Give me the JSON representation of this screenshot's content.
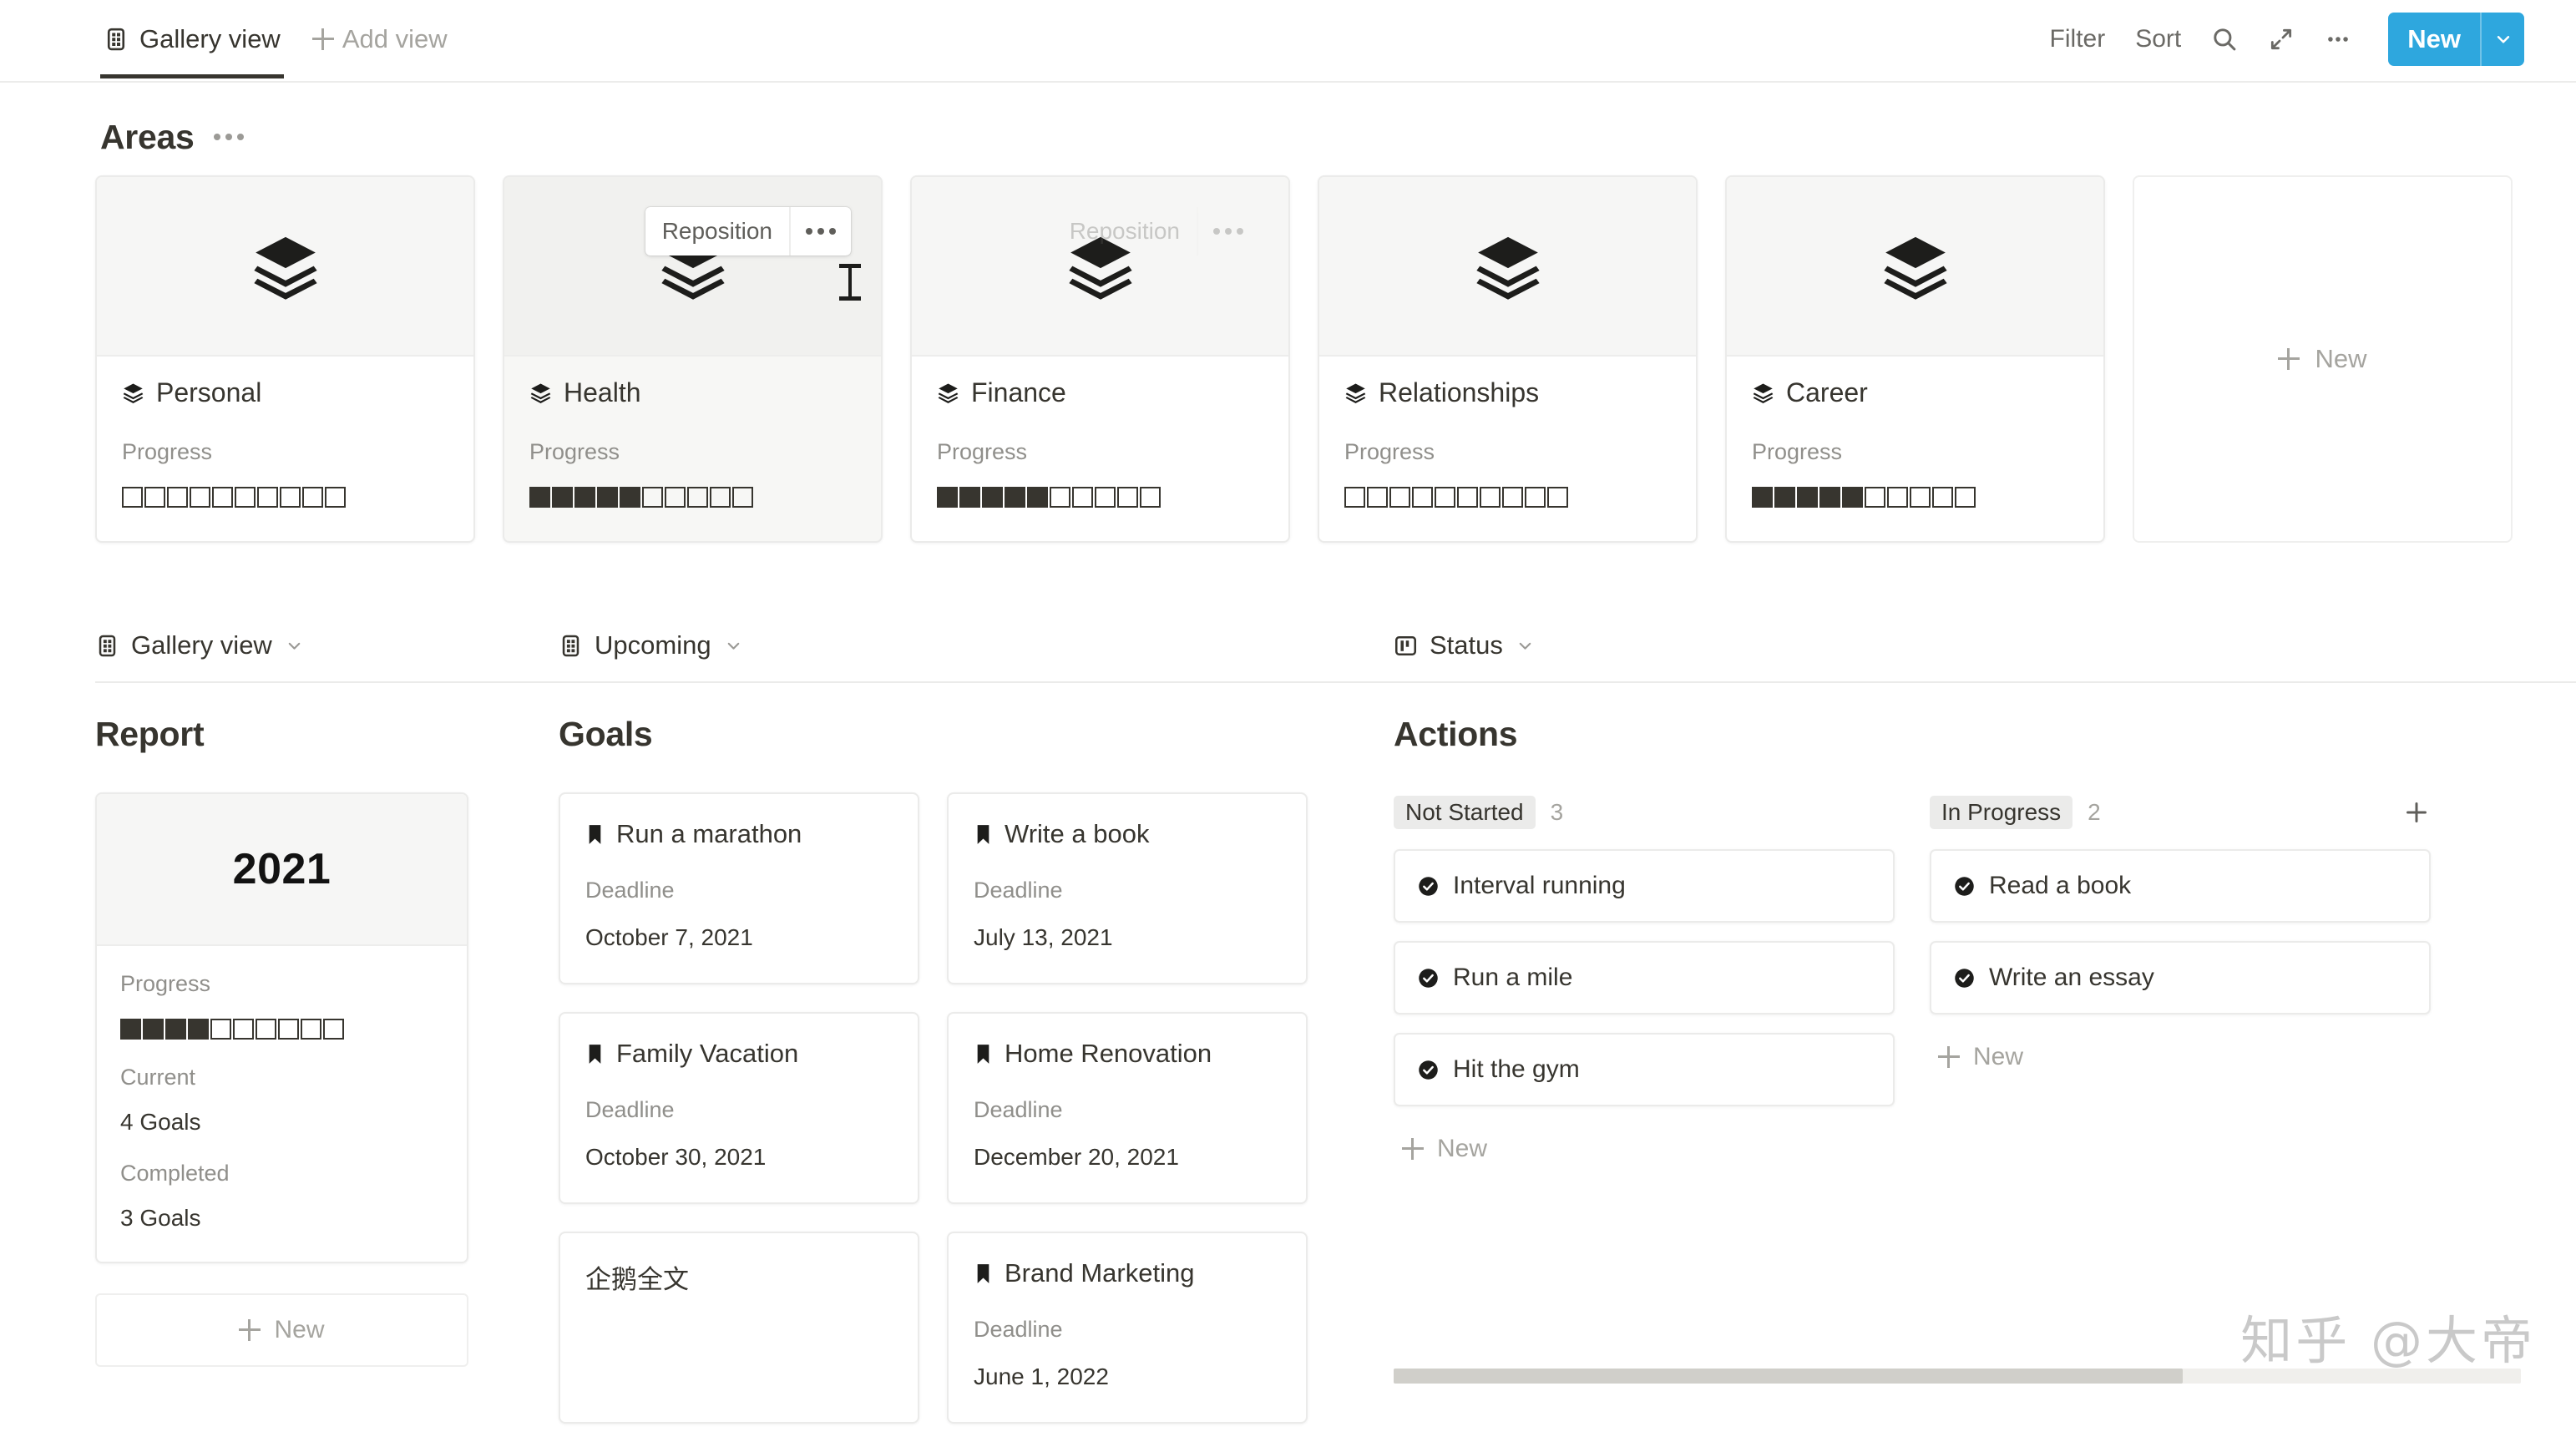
{
  "topbar": {
    "view_tab": {
      "label": "Gallery view",
      "icon": "gallery-grid-icon"
    },
    "add_view": {
      "label": "Add view",
      "icon": "plus-icon"
    },
    "filter_label": "Filter",
    "sort_label": "Sort",
    "search_icon": "search-icon",
    "expand_icon": "expand-arrows-icon",
    "more_icon": "ellipsis-icon",
    "new_button": {
      "label": "New",
      "caret_icon": "chevron-down-icon",
      "color": "#2ea7de"
    }
  },
  "areas_section": {
    "title": "Areas",
    "more_icon": "ellipsis-icon",
    "cards": [
      {
        "title": "Personal",
        "icon": "layers-icon",
        "progress_label": "Progress",
        "filled": 0,
        "total": 10,
        "hovered": false,
        "overlay": "none"
      },
      {
        "title": "Health",
        "icon": "layers-icon",
        "progress_label": "Progress",
        "filled": 5,
        "total": 10,
        "hovered": true,
        "overlay": "active"
      },
      {
        "title": "Finance",
        "icon": "layers-icon",
        "progress_label": "Progress",
        "filled": 5,
        "total": 10,
        "hovered": false,
        "overlay": "ghost"
      },
      {
        "title": "Relationships",
        "icon": "layers-icon",
        "progress_label": "Progress",
        "filled": 0,
        "total": 10,
        "hovered": false,
        "overlay": "none"
      },
      {
        "title": "Career",
        "icon": "layers-icon",
        "progress_label": "Progress",
        "filled": 5,
        "total": 10,
        "hovered": false,
        "overlay": "none"
      }
    ],
    "reposition_label": "Reposition",
    "reposition_dots_icon": "ellipsis-icon",
    "new_card_label": "New"
  },
  "report_column": {
    "linked_view": {
      "label": "Gallery view",
      "icon": "gallery-grid-icon",
      "caret_icon": "chevron-down-icon"
    },
    "db_title": "Report",
    "card": {
      "cover_text": "2021",
      "progress_label": "Progress",
      "filled": 4,
      "total": 10,
      "current_label": "Current",
      "current_value": "4 Goals",
      "completed_label": "Completed",
      "completed_value": "3 Goals"
    },
    "new_label": "New"
  },
  "goals_column": {
    "linked_view": {
      "label": "Upcoming",
      "icon": "gallery-grid-icon",
      "caret_icon": "chevron-down-icon"
    },
    "db_title": "Goals",
    "cards": [
      {
        "title": "Run a marathon",
        "icon": "bookmark-icon",
        "deadline_label": "Deadline",
        "deadline": "October 7, 2021"
      },
      {
        "title": "Write a book",
        "icon": "bookmark-icon",
        "deadline_label": "Deadline",
        "deadline": "July 13, 2021"
      },
      {
        "title": "Family Vacation",
        "icon": "bookmark-icon",
        "deadline_label": "Deadline",
        "deadline": "October 30, 2021"
      },
      {
        "title": "Home Renovation",
        "icon": "bookmark-icon",
        "deadline_label": "Deadline",
        "deadline": "December 20, 2021"
      },
      {
        "title": "企鹅全文",
        "icon": "none",
        "deadline_label": "",
        "deadline": ""
      },
      {
        "title": "Brand Marketing",
        "icon": "bookmark-icon",
        "deadline_label": "Deadline",
        "deadline": "June 1, 2022"
      }
    ]
  },
  "status_column": {
    "linked_view": {
      "label": "Status",
      "icon": "board-kanban-icon",
      "caret_icon": "chevron-down-icon"
    },
    "db_title": "Actions",
    "add_icon": "plus-icon",
    "columns": [
      {
        "status": "Not Started",
        "count": "3",
        "new_label": "New",
        "cards": [
          {
            "title": "Interval running",
            "icon": "check-circle-icon"
          },
          {
            "title": "Run a mile",
            "icon": "check-circle-icon"
          },
          {
            "title": "Hit the gym",
            "icon": "check-circle-icon"
          }
        ]
      },
      {
        "status": "In Progress",
        "count": "2",
        "new_label": "New",
        "cards": [
          {
            "title": "Read a book",
            "icon": "check-circle-icon"
          },
          {
            "title": "Write an essay",
            "icon": "check-circle-icon"
          }
        ]
      }
    ]
  },
  "watermark": "知乎 @大帝"
}
